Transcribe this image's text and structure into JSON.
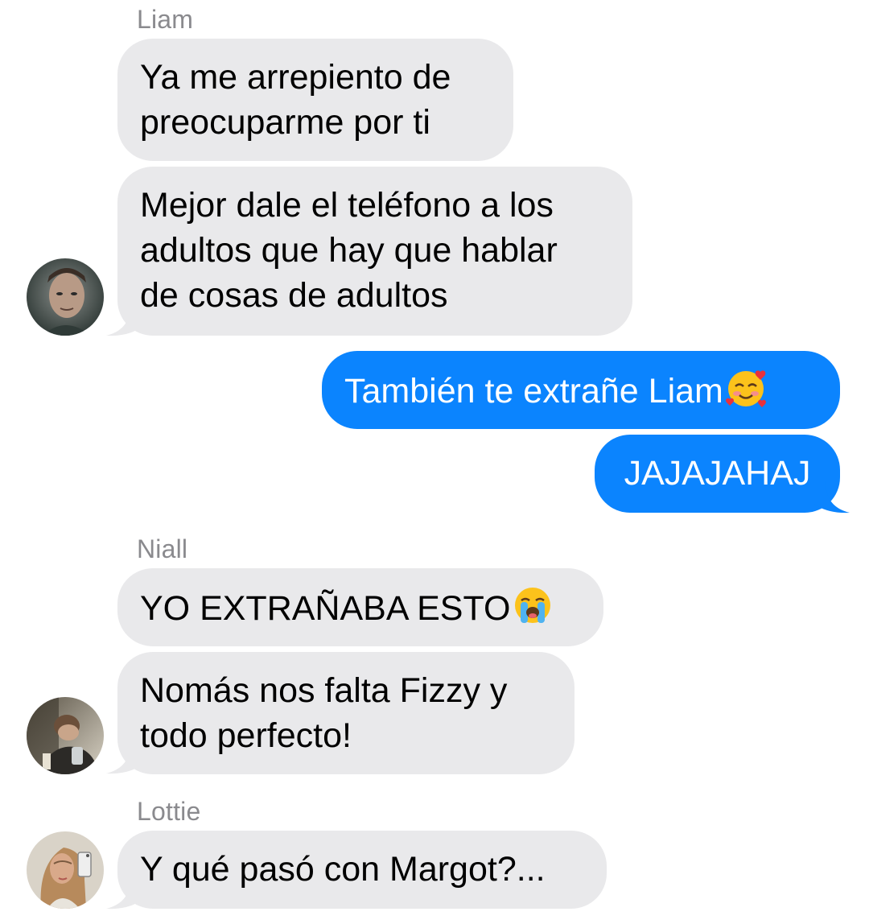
{
  "colors": {
    "incoming_bubble": "#e9e9eb",
    "outgoing_bubble": "#0b84fe",
    "sender_name": "#8a8a8e"
  },
  "thread": [
    {
      "sender": "Liam",
      "avatar": "liam-avatar",
      "messages": [
        "Ya me arrepiento de\npreocuparme por ti",
        "Mejor dale el teléfono a los\nadultos que hay que hablar\nde cosas de adultos"
      ]
    },
    {
      "sender": "me",
      "messages": [
        {
          "text": "También te extrañe Liam",
          "emoji": "smiling-face-with-hearts-icon"
        },
        "JAJAJAHAJ"
      ]
    },
    {
      "sender": "Niall",
      "avatar": "niall-avatar",
      "messages": [
        {
          "text": "YO EXTRAÑABA ESTO",
          "emoji": "loudly-crying-face-icon"
        },
        "Nomás nos falta Fizzy y\ntodo perfecto!"
      ]
    },
    {
      "sender": "Lottie",
      "avatar": "lottie-avatar",
      "messages": [
        "Y qué pasó con Margot?..."
      ]
    }
  ]
}
